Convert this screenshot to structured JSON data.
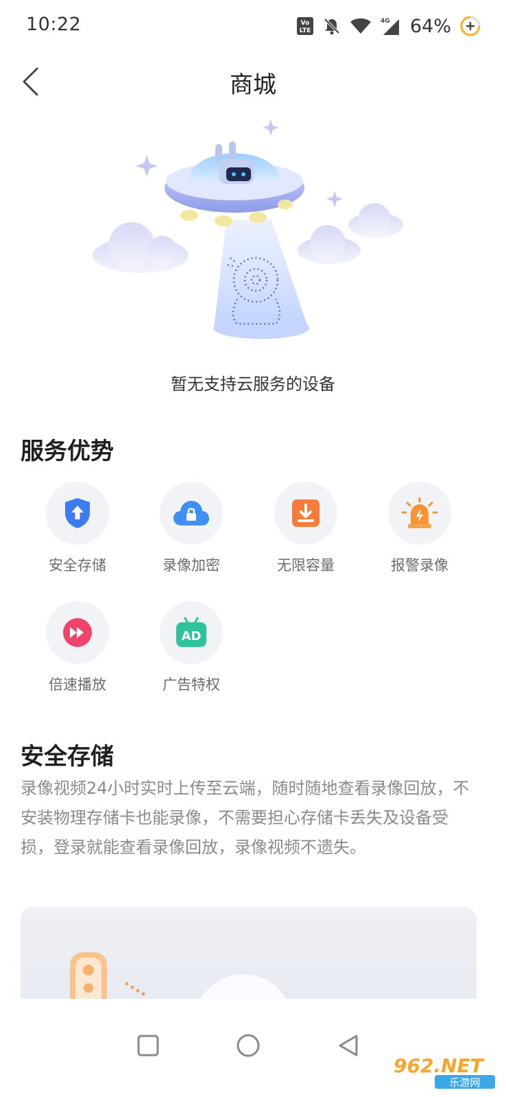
{
  "status_bar": {
    "time": "10:22",
    "battery": "64%",
    "icons": [
      "volte-icon",
      "bell-off-icon",
      "wifi-icon",
      "signal-4g-icon",
      "battery-saver-icon"
    ],
    "network_label": "4G",
    "volte_label_top": "Vo",
    "volte_label_bottom": "LTE"
  },
  "header": {
    "title": "商城",
    "back_icon": "chevron-left-icon"
  },
  "empty_state": {
    "message": "暂无支持云服务的设备",
    "illustration": "ufo-robot-camera-illustration"
  },
  "features": {
    "title": "服务优势",
    "items": [
      {
        "label": "安全存储",
        "icon": "shield-upload-icon",
        "color": "#3d7cf0"
      },
      {
        "label": "录像加密",
        "icon": "cloud-lock-icon",
        "color": "#3f8ff5"
      },
      {
        "label": "无限容量",
        "icon": "download-box-icon",
        "color": "#f57c3a"
      },
      {
        "label": "报警录像",
        "icon": "alarm-light-icon",
        "color": "#f79433"
      },
      {
        "label": "倍速播放",
        "icon": "fast-forward-icon",
        "color": "#f0436b"
      },
      {
        "label": "广告特权",
        "icon": "ad-tv-icon",
        "color": "#2ec39a",
        "badge_text": "AD"
      }
    ]
  },
  "storage": {
    "title": "安全存储",
    "description": "录像视频24小时实时上传至云端，随时随地查看录像回放，不安装物理存储卡也能录像，不需要担心存储卡丢失及设备受损，登录就能查看录像回放，录像视频不遗失。"
  },
  "nav_bar": {
    "buttons": [
      "square-icon",
      "circle-icon",
      "triangle-back-icon"
    ]
  },
  "watermark": {
    "text_top": "962.NET",
    "text_bottom": "乐游网"
  },
  "colors": {
    "accent_blue": "#3d7cf0",
    "text_primary": "#222222",
    "text_secondary": "#8a8a8a"
  }
}
